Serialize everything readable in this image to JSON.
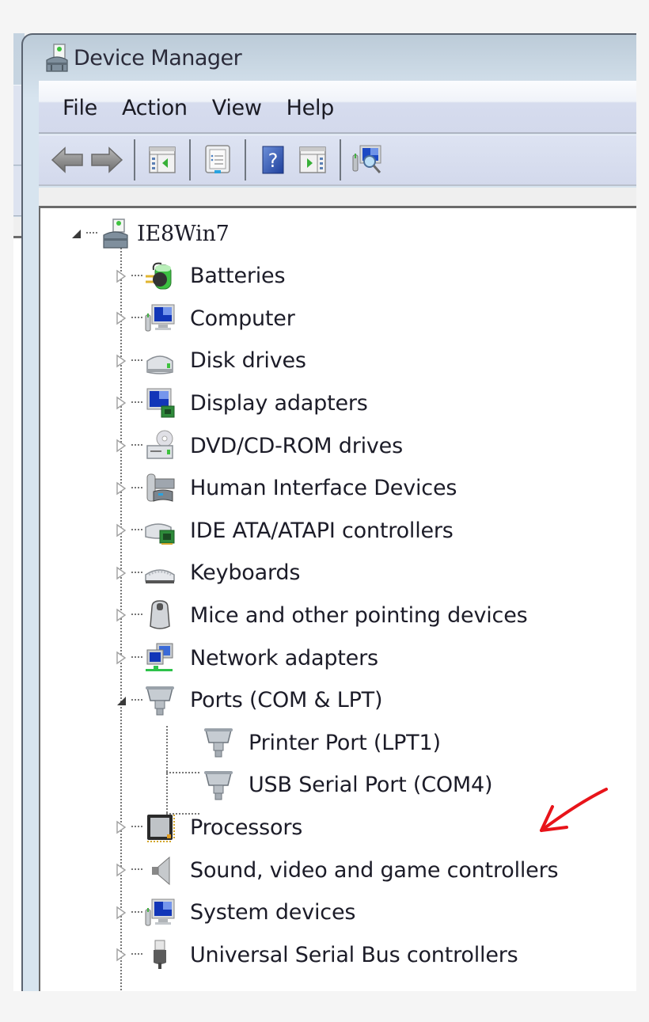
{
  "window": {
    "title": "Device Manager",
    "title_icon": "device-manager-icon"
  },
  "menubar": {
    "items": [
      {
        "label": "File"
      },
      {
        "label": "Action"
      },
      {
        "label": "View"
      },
      {
        "label": "Help"
      }
    ]
  },
  "toolbar": {
    "buttons": [
      {
        "name": "back",
        "icon": "arrow-left-icon"
      },
      {
        "name": "forward",
        "icon": "arrow-right-icon"
      },
      {
        "name": "show-hide-console-tree",
        "icon": "console-tree-icon"
      },
      {
        "name": "properties",
        "icon": "properties-icon"
      },
      {
        "name": "help",
        "icon": "help-icon"
      },
      {
        "name": "show-hide-action-pane",
        "icon": "action-pane-icon"
      },
      {
        "name": "scan-hardware-changes",
        "icon": "scan-hardware-icon"
      }
    ]
  },
  "tree": {
    "root": {
      "label": "IE8Win7",
      "expanded": true,
      "icon": "computer-toolbox-icon"
    },
    "categories": [
      {
        "label": "Batteries",
        "icon": "battery-icon",
        "expanded": false
      },
      {
        "label": "Computer",
        "icon": "computer-icon",
        "expanded": false
      },
      {
        "label": "Disk drives",
        "icon": "disk-drive-icon",
        "expanded": false
      },
      {
        "label": "Display adapters",
        "icon": "display-adapter-icon",
        "expanded": false
      },
      {
        "label": "DVD/CD-ROM drives",
        "icon": "dvd-drive-icon",
        "expanded": false
      },
      {
        "label": "Human Interface Devices",
        "icon": "hid-icon",
        "expanded": false
      },
      {
        "label": "IDE ATA/ATAPI controllers",
        "icon": "ide-controller-icon",
        "expanded": false
      },
      {
        "label": "Keyboards",
        "icon": "keyboard-icon",
        "expanded": false
      },
      {
        "label": "Mice and other pointing devices",
        "icon": "mouse-icon",
        "expanded": false
      },
      {
        "label": "Network adapters",
        "icon": "network-adapter-icon",
        "expanded": false
      },
      {
        "label": "Ports (COM & LPT)",
        "icon": "port-icon",
        "expanded": true,
        "children": [
          {
            "label": "Printer Port (LPT1)",
            "icon": "port-icon"
          },
          {
            "label": "USB Serial Port (COM4)",
            "icon": "port-icon",
            "annotated": true
          }
        ]
      },
      {
        "label": "Processors",
        "icon": "processor-icon",
        "expanded": false
      },
      {
        "label": "Sound, video and game controllers",
        "icon": "speaker-icon",
        "expanded": false
      },
      {
        "label": "System devices",
        "icon": "system-device-icon",
        "expanded": false
      },
      {
        "label": "Universal Serial Bus controllers",
        "icon": "usb-icon",
        "expanded": false
      }
    ]
  },
  "annotation": {
    "type": "arrow",
    "color": "#e8141a",
    "points_to": "USB Serial Port (COM4)"
  }
}
